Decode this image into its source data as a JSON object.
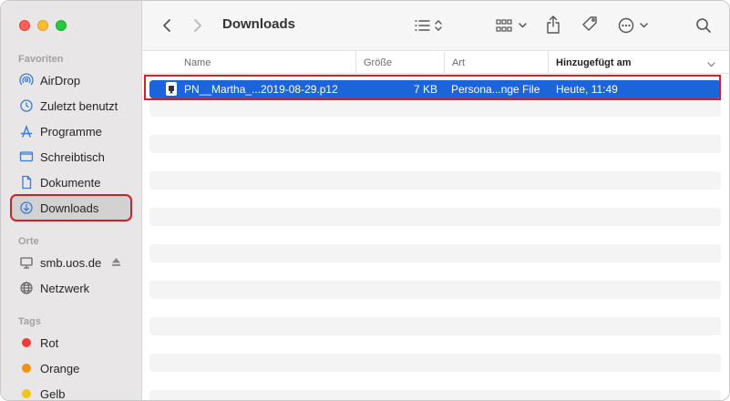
{
  "window": {
    "title": "Downloads"
  },
  "sidebar": {
    "favorites_title": "Favoriten",
    "favorites": [
      {
        "label": "AirDrop",
        "icon": "airdrop-icon"
      },
      {
        "label": "Zuletzt benutzt",
        "icon": "clock-icon"
      },
      {
        "label": "Programme",
        "icon": "apps-icon"
      },
      {
        "label": "Schreibtisch",
        "icon": "desktop-icon"
      },
      {
        "label": "Dokumente",
        "icon": "document-icon"
      },
      {
        "label": "Downloads",
        "icon": "download-icon",
        "selected": true
      }
    ],
    "locations_title": "Orte",
    "locations": [
      {
        "label": "smb.uos.de",
        "icon": "server-icon"
      },
      {
        "label": "Netzwerk",
        "icon": "network-icon"
      }
    ],
    "tags_title": "Tags",
    "tags": [
      {
        "label": "Rot",
        "color": "#ee3b35"
      },
      {
        "label": "Orange",
        "color": "#f29113"
      },
      {
        "label": "Gelb",
        "color": "#f1c515"
      }
    ]
  },
  "columns": {
    "name": "Name",
    "size": "Größe",
    "kind": "Art",
    "added": "Hinzugefügt am"
  },
  "files": [
    {
      "name": "PN__Martha_...2019-08-29.p12",
      "size": "7 KB",
      "kind": "Persona...nge File",
      "added": "Heute, 11:49",
      "selected": true
    }
  ],
  "colors": {
    "selection": "#1c64d9",
    "highlight_border": "#d41f2b"
  }
}
